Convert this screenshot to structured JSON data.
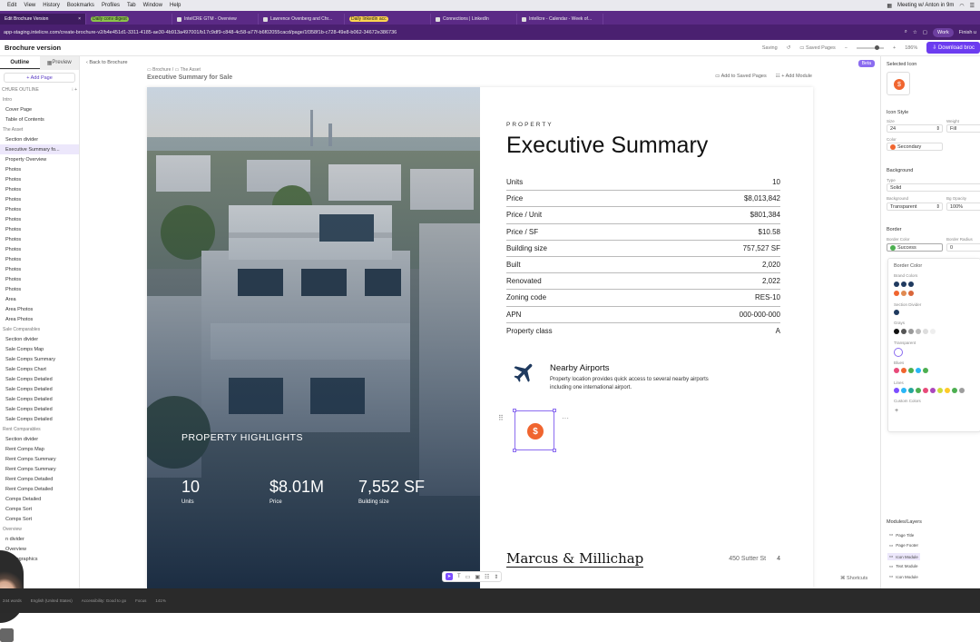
{
  "menubar": {
    "items": [
      "Edit",
      "View",
      "History",
      "Bookmarks",
      "Profiles",
      "Tab",
      "Window",
      "Help"
    ],
    "meeting": "Meeting w/ Anton in 9m"
  },
  "tabs": [
    {
      "label": "Edit Brochure Version",
      "active": true
    },
    {
      "label": "Daily conv digest",
      "pill": true
    },
    {
      "label": "IntelCRE GTM - Overview"
    },
    {
      "label": "Lawrence Ovenberg and Chr..."
    },
    {
      "label": "Daily linkedin acc",
      "pill": true
    },
    {
      "label": "Connections | LinkedIn"
    },
    {
      "label": "Intellcre - Calendar - Week of..."
    }
  ],
  "url": "app-staging.intelicre.com/create-brochure-v2/b4e451d1-3311-4185-ae30-4b913a497001/b17c9df9-c848-4c58-a77f-b6f02055cacd/page/1f358f1b-c728-49e8-b062-34672e386736",
  "browser": {
    "work": "Work",
    "finish": "Finish u"
  },
  "app": {
    "title": "Brochure version",
    "saving": "Saving",
    "saved_pages": "Saved Pages",
    "zoom": "186%",
    "download": "Download broc"
  },
  "sidebar": {
    "tab_outline": "Outline",
    "tab_preview": "Preview",
    "add_page": "+ Add Page",
    "outline_label": "CHURE OUTLINE",
    "items": [
      {
        "label": "Intro",
        "sec": true
      },
      {
        "label": "Cover Page"
      },
      {
        "label": "Table of Contents"
      },
      {
        "label": "The Asset",
        "sec": true
      },
      {
        "label": "Section divider"
      },
      {
        "label": "Executive Summary fo...",
        "sel": true
      },
      {
        "label": "Property Overview"
      },
      {
        "label": "Photos"
      },
      {
        "label": "Photos"
      },
      {
        "label": "Photos"
      },
      {
        "label": "Photos"
      },
      {
        "label": "Photos"
      },
      {
        "label": "Photos"
      },
      {
        "label": "Photos"
      },
      {
        "label": "Photos"
      },
      {
        "label": "Photos"
      },
      {
        "label": "Photos"
      },
      {
        "label": "Photos"
      },
      {
        "label": "Photos"
      },
      {
        "label": "Photos"
      },
      {
        "label": "Area"
      },
      {
        "label": "Area Photos"
      },
      {
        "label": "Area Photos"
      },
      {
        "label": "Sale Comparables",
        "sec": true
      },
      {
        "label": "Section divider"
      },
      {
        "label": "Sale Comps Map"
      },
      {
        "label": "Sale Comps Summary"
      },
      {
        "label": "Sale Comps Chart"
      },
      {
        "label": "Sale Comps Detailed"
      },
      {
        "label": "Sale Comps Detailed"
      },
      {
        "label": "Sale Comps Detailed"
      },
      {
        "label": "Sale Comps Detailed"
      },
      {
        "label": "Sale Comps Detailed"
      },
      {
        "label": "Rent Comparables",
        "sec": true
      },
      {
        "label": "Section divider"
      },
      {
        "label": "Rent Comps Map"
      },
      {
        "label": "Rent Comps Summary"
      },
      {
        "label": "Rent Comps Summary"
      },
      {
        "label": "Rent Comps Detailed"
      },
      {
        "label": "Rent Comps Detailed"
      },
      {
        "label": "Comps Detailed"
      },
      {
        "label": "Comps Sort"
      },
      {
        "label": "Comps Sort"
      },
      {
        "label": "Overview",
        "sec": true
      },
      {
        "label": "n divider"
      },
      {
        "label": "Overview"
      },
      {
        "label": "Demographics"
      }
    ]
  },
  "canvas": {
    "back": "Back to Brochure",
    "crumb_a": "Brochure",
    "crumb_b": "The Asset",
    "doc_title": "Executive Summary for Sale",
    "add_saved": "Add to Saved Pages",
    "add_module": "+ Add Module",
    "beta": "Beta",
    "shortcuts": "Shortcuts"
  },
  "page": {
    "highlights_title": "PROPERTY HIGHLIGHTS",
    "highlights": [
      {
        "value": "10",
        "label": "Units"
      },
      {
        "value": "$8.01M",
        "label": "Price"
      },
      {
        "value": "7,552 SF",
        "label": "Building size"
      }
    ],
    "eyebrow": "PROPERTY",
    "heading": "Executive Summary",
    "stats": [
      {
        "label": "Units",
        "value": "10"
      },
      {
        "label": "Price",
        "value": "$8,013,842"
      },
      {
        "label": "Price / Unit",
        "value": "$801,384"
      },
      {
        "label": "Price / SF",
        "value": "$10.58"
      },
      {
        "label": "Building size",
        "value": "757,527 SF"
      },
      {
        "label": "Built",
        "value": "2,020"
      },
      {
        "label": "Renovated",
        "value": "2,022"
      },
      {
        "label": "Zoning code",
        "value": "RES-10"
      },
      {
        "label": "APN",
        "value": "000-000-000"
      },
      {
        "label": "Property class",
        "value": "A"
      }
    ],
    "nearby_title": "Nearby Airports",
    "nearby_desc": "Property location provides quick access to several nearby airports including one international airport.",
    "brand": "Marcus & Millichap",
    "address": "450 Sutter St",
    "page_number": "4"
  },
  "right_panel": {
    "selected_icon": "Selected Icon",
    "icon_style": "Icon Style",
    "size_label": "Size",
    "size_value": "24",
    "weight_label": "Weight",
    "weight_value": "Fill",
    "color_label": "Color",
    "color_value": "Secondary",
    "background": "Background",
    "type_label": "Type",
    "type_value": "Solid",
    "bg_label": "Background",
    "bg_value": "Transparent",
    "opacity_label": "Bg Opacity",
    "opacity_value": "100%",
    "border": "Border",
    "border_color_label": "Border Color",
    "border_color_value": "Success",
    "border_radius_label": "Border Radius",
    "border_radius_value": "0",
    "popover_title": "Border Color",
    "brand_colors": "Brand Colors",
    "section_divider": "Section Divider",
    "grays": "Grays",
    "transparent": "Transparent",
    "blues": "Blues",
    "lines": "Lines",
    "custom_colors": "Custom Colors",
    "modules_layers": "Modules/Layers",
    "layers": [
      "Page Title",
      "Page Footer",
      "Icon Module",
      "Text Module",
      "Icon Module"
    ],
    "colors": {
      "accent": "#6c3cf0",
      "icon": "#f0652f",
      "success": "#4caf50"
    }
  },
  "statusbar": {
    "words": "244 words",
    "lang": "English (United States)",
    "access": "Accessibility: Good to go",
    "focus": "Focus",
    "zoom": "141%"
  }
}
